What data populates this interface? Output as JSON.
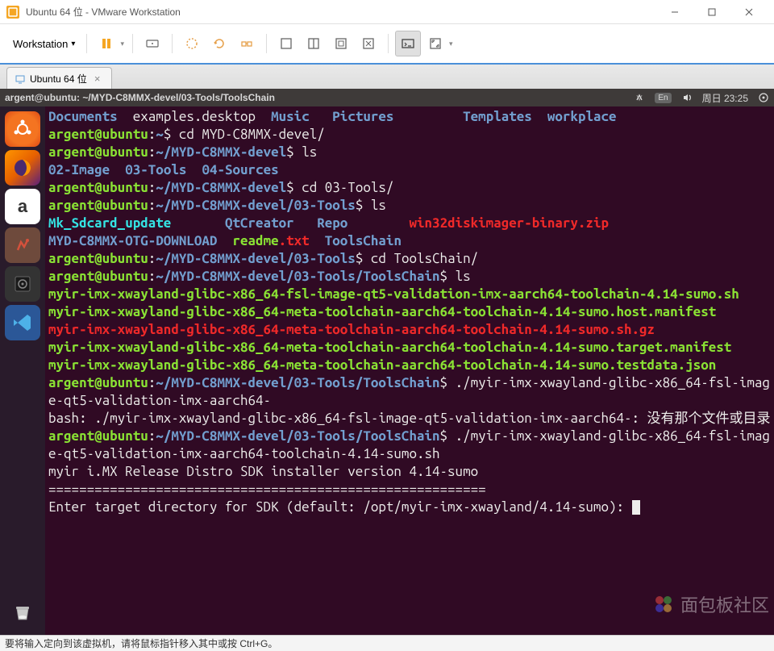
{
  "window": {
    "title": "Ubuntu 64 位 - VMware Workstation"
  },
  "toolbar": {
    "menu": "Workstation"
  },
  "tab": {
    "label": "Ubuntu 64 位"
  },
  "panel": {
    "title": "argent@ubuntu: ~/MYD-C8MMX-devel/03-Tools/ToolsChain",
    "lang": "En",
    "datetime": "周日 23:25"
  },
  "terminal": {
    "dirs_line1": [
      "Documents",
      "examples.desktop",
      "Music",
      "Pictures",
      "Templates",
      "workplace"
    ],
    "prompt_user": "argent@ubuntu",
    "path_home": "~",
    "path_devel": "~/MYD-C8MMX-devel",
    "path_tools": "~/MYD-C8MMX-devel/03-Tools",
    "path_chain": "~/MYD-C8MMX-devel/03-Tools/ToolsChain",
    "cmd_cd1": "cd MYD-C8MMX-devel/",
    "cmd_ls": "ls",
    "dirs_devel": [
      "02-Image",
      "03-Tools",
      "04-Sources"
    ],
    "cmd_cd2": "cd 03-Tools/",
    "tools_entries": {
      "mk": "Mk_Sdcard_update",
      "qt": "QtCreator",
      "repo": "Repo",
      "win32": "win32diskimager-binary.zip",
      "otg": "MYD-C8MMX-OTG-DOWNLOAD",
      "readme_name": "readme",
      "readme_ext": ".txt",
      "chain": "ToolsChain"
    },
    "cmd_cd3": "cd ToolsChain/",
    "chain_files": [
      "myir-imx-xwayland-glibc-x86_64-fsl-image-qt5-validation-imx-aarch64-toolchain-4.14-sumo.sh",
      "myir-imx-xwayland-glibc-x86_64-meta-toolchain-aarch64-toolchain-4.14-sumo.host.manifest",
      "myir-imx-xwayland-glibc-x86_64-meta-toolchain-aarch64-toolchain-4.14-sumo.sh.gz",
      "myir-imx-xwayland-glibc-x86_64-meta-toolchain-aarch64-toolchain-4.14-sumo.target.manifest",
      "myir-imx-xwayland-glibc-x86_64-meta-toolchain-aarch64-toolchain-4.14-sumo.testdata.json"
    ],
    "cmd_run1": "./myir-imx-xwayland-glibc-x86_64-fsl-image-qt5-validation-imx-aarch64-",
    "bash_err1": "bash: ./myir-imx-xwayland-glibc-x86_64-fsl-image-qt5-validation-imx-aarch64-: 没有那个文件或目录",
    "cmd_run2": "./myir-imx-xwayland-glibc-x86_64-fsl-image-qt5-validation-imx-aarch64-toolchain-4.14-sumo.sh",
    "sdk_line": "myir i.MX Release Distro SDK installer version 4.14-sumo",
    "sdk_sep": "=========================================================",
    "sdk_prompt": "Enter target directory for SDK (default: /opt/myir-imx-xwayland/4.14-sumo): "
  },
  "statusbar": {
    "text": "要将输入定向到该虚拟机，请将鼠标指针移入其中或按 Ctrl+G。"
  },
  "watermark": {
    "text": "面包板社区"
  }
}
